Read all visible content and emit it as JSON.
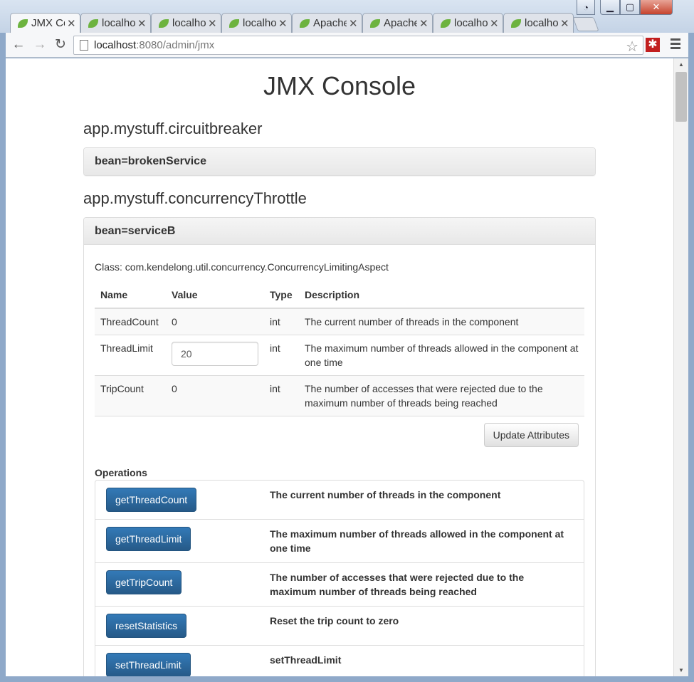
{
  "browser": {
    "tabs": [
      {
        "label": "JMX Co",
        "active": true
      },
      {
        "label": "localho",
        "active": false
      },
      {
        "label": "localho",
        "active": false
      },
      {
        "label": "localho",
        "active": false
      },
      {
        "label": "Apache",
        "active": false
      },
      {
        "label": "Apache",
        "active": false
      },
      {
        "label": "localho",
        "active": false
      },
      {
        "label": "localho",
        "active": false
      }
    ],
    "url_host": "localhost",
    "url_rest": ":8080/admin/jmx"
  },
  "page": {
    "title": "JMX Console",
    "domains": [
      {
        "name": "app.mystuff.circuitbreaker",
        "bean": "bean=brokenService"
      },
      {
        "name": "app.mystuff.concurrencyThrottle",
        "bean": "bean=serviceB",
        "class_line": "Class: com.kendelong.util.concurrency.ConcurrencyLimitingAspect",
        "attributes_headers": {
          "name": "Name",
          "value": "Value",
          "type": "Type",
          "description": "Description"
        },
        "attributes": [
          {
            "name": "ThreadCount",
            "value": "0",
            "type": "int",
            "description": "The current number of threads in the component"
          },
          {
            "name": "ThreadLimit",
            "value": "20",
            "type": "int",
            "description": "The maximum number of threads allowed in the component at one time"
          },
          {
            "name": "TripCount",
            "value": "0",
            "type": "int",
            "description": "The number of accesses that were rejected due to the maximum number of threads being reached"
          }
        ],
        "update_label": "Update Attributes",
        "operations_title": "Operations",
        "operations": [
          {
            "label": "getThreadCount",
            "description": "The current number of threads in the component"
          },
          {
            "label": "getThreadLimit",
            "description": "The maximum number of threads allowed in the component at one time"
          },
          {
            "label": "getTripCount",
            "description": "The number of accesses that were rejected due to the maximum number of threads being reached"
          },
          {
            "label": "resetStatistics",
            "description": "Reset the trip count to zero"
          },
          {
            "label": "setThreadLimit",
            "description": "setThreadLimit"
          }
        ]
      }
    ]
  }
}
